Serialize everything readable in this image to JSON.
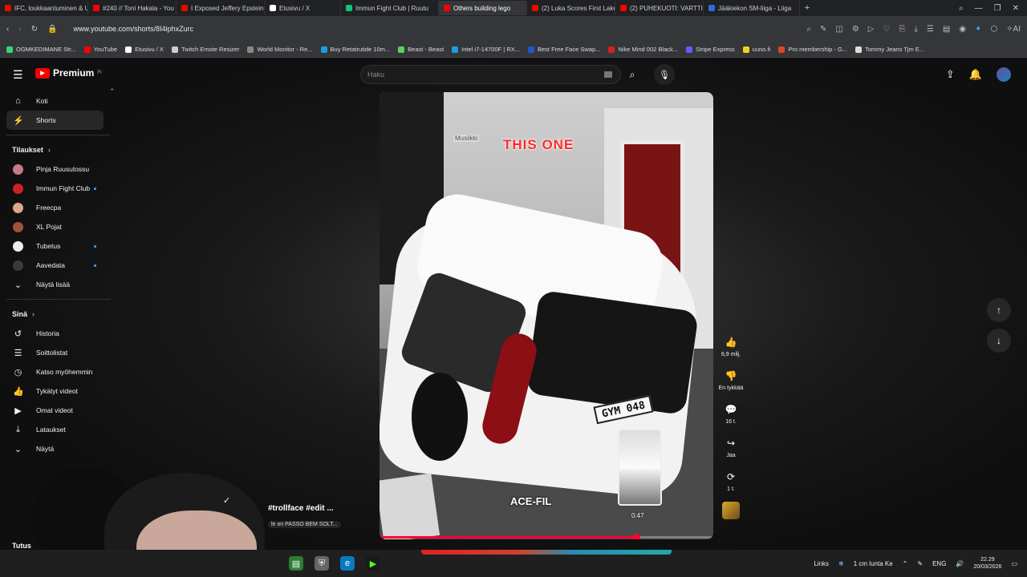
{
  "browser": {
    "tabs": [
      {
        "label": "IFC, loukkaantuminen & U",
        "color": "#ff0000"
      },
      {
        "label": "#240 // Toni Hakala - You",
        "color": "#ff0000"
      },
      {
        "label": "I Exposed Jeffery Epstein's",
        "color": "#ff0000"
      },
      {
        "label": "Etusivu / X",
        "color": "#ffffff"
      },
      {
        "label": "Immun Fight Club | Ruutu",
        "color": "#13c17a"
      },
      {
        "label": "Others building lego",
        "color": "#ff0000",
        "active": true
      },
      {
        "label": "(2) Luka Scores First Laker",
        "color": "#ff0000"
      },
      {
        "label": "(2) PUHEKUOTI: VARTTI ISBE",
        "color": "#ff0000"
      },
      {
        "label": "Jääkiekon SM-liiga - Liiga",
        "color": "#2b6fd6"
      }
    ],
    "url": "www.youtube.com/shorts/8I4iphxZurc",
    "bookmarks": [
      {
        "label": "OGMKEDIMANE Str...",
        "color": "#3bd27a"
      },
      {
        "label": "YouTube",
        "color": "#ff0000"
      },
      {
        "label": "Etusivu / X",
        "color": "#ffffff"
      },
      {
        "label": "Twitch Emote Resizer",
        "color": "#cccccc"
      },
      {
        "label": "World Monitor - Re...",
        "color": "#888888"
      },
      {
        "label": "Buy Retatrutide 10m...",
        "color": "#1e9be0"
      },
      {
        "label": "Beast - Beast",
        "color": "#5ad15a"
      },
      {
        "label": "Intel i7-14700F | RX...",
        "color": "#1e9be0"
      },
      {
        "label": "Best Free Face Swap...",
        "color": "#2255cc"
      },
      {
        "label": "Nike Mind 002 Black...",
        "color": "#d22222"
      },
      {
        "label": "Stripe Express",
        "color": "#635bff"
      },
      {
        "label": "uuno.fi",
        "color": "#f2d21e"
      },
      {
        "label": "Pro membership - G...",
        "color": "#e0452a"
      },
      {
        "label": "Tommy Jeans Tjm E...",
        "color": "#dddddd"
      }
    ]
  },
  "header": {
    "logo": "Premium",
    "logo_sup": "FI",
    "search_placeholder": "Haku"
  },
  "sidebar": {
    "main": [
      {
        "label": "Koti",
        "icon": "⌂"
      },
      {
        "label": "Shorts",
        "icon": "⚡",
        "active": true
      }
    ],
    "subs_title": "Tilaukset",
    "subs": [
      {
        "label": "Pinja Ruusutossu",
        "color": "#c47b8a",
        "live": false
      },
      {
        "label": "Immun Fight Club",
        "color": "#cc2222",
        "live": true
      },
      {
        "label": "Freecpa",
        "color": "#d9a88a",
        "live": false
      },
      {
        "label": "XL Pojat",
        "color": "#a0523d",
        "live": false
      },
      {
        "label": "Tubetus",
        "color": "#eeeeee",
        "live": true
      },
      {
        "label": "Aavedata",
        "color": "#3a3a3a",
        "live": true
      },
      {
        "label": "Näytä lisää",
        "color": "",
        "live": false
      }
    ],
    "you_title": "Sinä",
    "you": [
      {
        "label": "Historia",
        "icon": "↺"
      },
      {
        "label": "Soittolistat",
        "icon": "☰"
      },
      {
        "label": "Katso myöhemmin",
        "icon": "◷"
      },
      {
        "label": "Tykätyt videot",
        "icon": "👍"
      },
      {
        "label": "Omat videot",
        "icon": "▶"
      },
      {
        "label": "Lataukset",
        "icon": "⤓"
      },
      {
        "label": "Näytä",
        "icon": "⌄"
      }
    ],
    "tutus": "Tutus"
  },
  "short": {
    "music_tag": "Musiikki",
    "caption": "THIS ONE",
    "plate": "GYM 048",
    "watermark": "ACE-FIL",
    "preview_time": "0:47",
    "overlay_title": "#trollface #edit ...",
    "overlay_sub": "le on PASSO BEM SOLT...",
    "progress": 0.77
  },
  "actions": {
    "likes": "6,9 milj.",
    "dislike": "En tykkää",
    "comments": "16 t.",
    "share": "Jaa",
    "remix": "1 t."
  },
  "taskbar": {
    "links": "Links",
    "weather": "1 cm lunta Ke",
    "lang": "ENG",
    "time": "22.29",
    "date": "20/03/2026"
  }
}
